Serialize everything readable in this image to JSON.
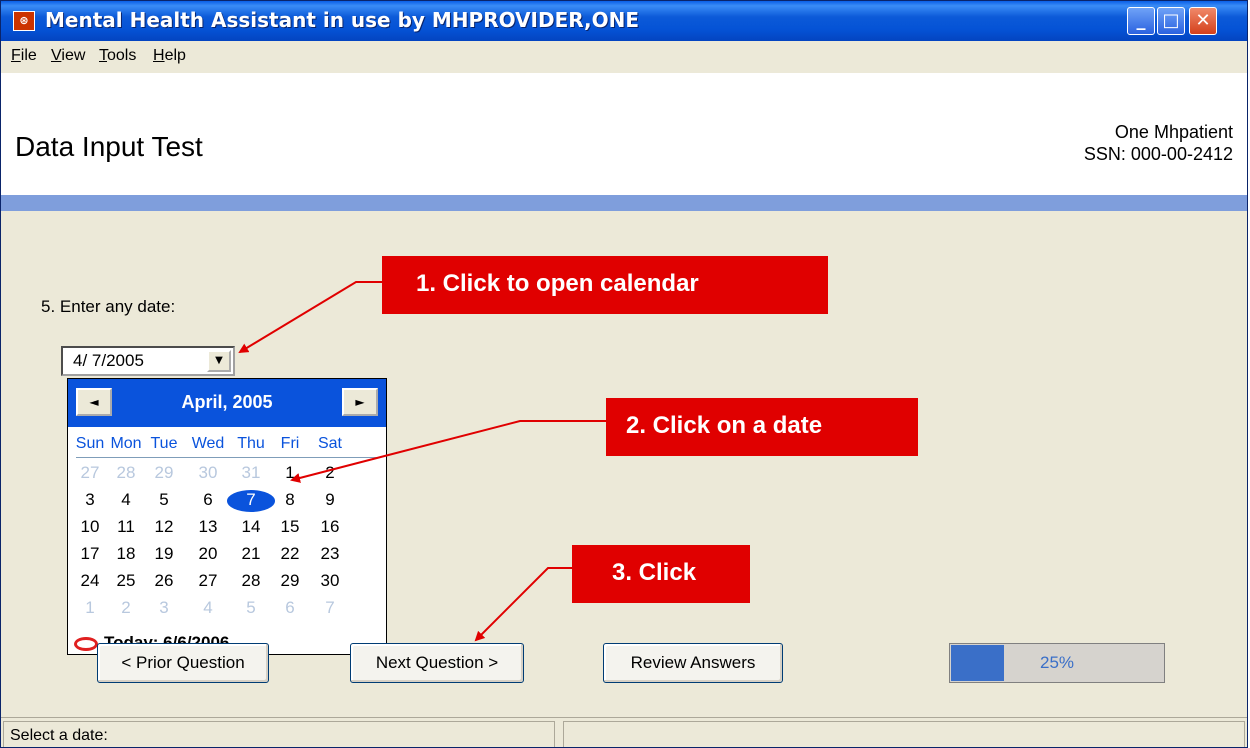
{
  "window": {
    "title": "Mental Health Assistant in use by MHPROVIDER,ONE",
    "icon": "app-icon",
    "controls": {
      "minimize": "_",
      "maximize": "□",
      "close": "✕"
    }
  },
  "menu": {
    "items": [
      {
        "label": "File",
        "mnemonic": "F"
      },
      {
        "label": "View",
        "mnemonic": "V"
      },
      {
        "label": "Tools",
        "mnemonic": "T"
      },
      {
        "label": "Help",
        "mnemonic": "H"
      }
    ]
  },
  "header": {
    "title": "Data Input Test",
    "patient_name": "One Mhpatient",
    "patient_ssn": "SSN: 000-00-2412"
  },
  "question": {
    "label": "5. Enter any date:",
    "date_value": "4/ 7/2005",
    "dropdown_icon": "▼"
  },
  "calendar": {
    "month_label": "April, 2005",
    "prev_icon": "◄",
    "next_icon": "►",
    "weekdays": [
      "Sun",
      "Mon",
      "Tue",
      "Wed",
      "Thu",
      "Fri",
      "Sat"
    ],
    "weeks": [
      [
        {
          "d": "27",
          "dim": true
        },
        {
          "d": "28",
          "dim": true
        },
        {
          "d": "29",
          "dim": true
        },
        {
          "d": "30",
          "dim": true
        },
        {
          "d": "31",
          "dim": true
        },
        {
          "d": "1"
        },
        {
          "d": "2"
        }
      ],
      [
        {
          "d": "3"
        },
        {
          "d": "4"
        },
        {
          "d": "5"
        },
        {
          "d": "6"
        },
        {
          "d": "7",
          "selected": true
        },
        {
          "d": "8"
        },
        {
          "d": "9"
        }
      ],
      [
        {
          "d": "10"
        },
        {
          "d": "11"
        },
        {
          "d": "12"
        },
        {
          "d": "13"
        },
        {
          "d": "14"
        },
        {
          "d": "15"
        },
        {
          "d": "16"
        }
      ],
      [
        {
          "d": "17"
        },
        {
          "d": "18"
        },
        {
          "d": "19"
        },
        {
          "d": "20"
        },
        {
          "d": "21"
        },
        {
          "d": "22"
        },
        {
          "d": "23"
        }
      ],
      [
        {
          "d": "24"
        },
        {
          "d": "25"
        },
        {
          "d": "26"
        },
        {
          "d": "27"
        },
        {
          "d": "28"
        },
        {
          "d": "29"
        },
        {
          "d": "30"
        }
      ],
      [
        {
          "d": "1",
          "dim": true
        },
        {
          "d": "2",
          "dim": true
        },
        {
          "d": "3",
          "dim": true
        },
        {
          "d": "4",
          "dim": true
        },
        {
          "d": "5",
          "dim": true
        },
        {
          "d": "6",
          "dim": true
        },
        {
          "d": "7",
          "dim": true
        }
      ]
    ],
    "today_label": "Today: 6/6/2006"
  },
  "buttons": {
    "prior": "< Prior Question",
    "next": "Next Question >",
    "review": "Review Answers"
  },
  "progress": {
    "value": 0.25,
    "label": "25%"
  },
  "status": {
    "text": "Select a date:"
  },
  "annotations": {
    "step1": "1. Click to open calendar",
    "step2": "2. Click on a date",
    "step3": "3. Click",
    "color": "#e00000"
  },
  "colors": {
    "titlebar": "#0553d6",
    "accent_band": "#7f9edc",
    "calendar_header": "#0a53dc",
    "progress_fill": "#3a6fc8"
  }
}
